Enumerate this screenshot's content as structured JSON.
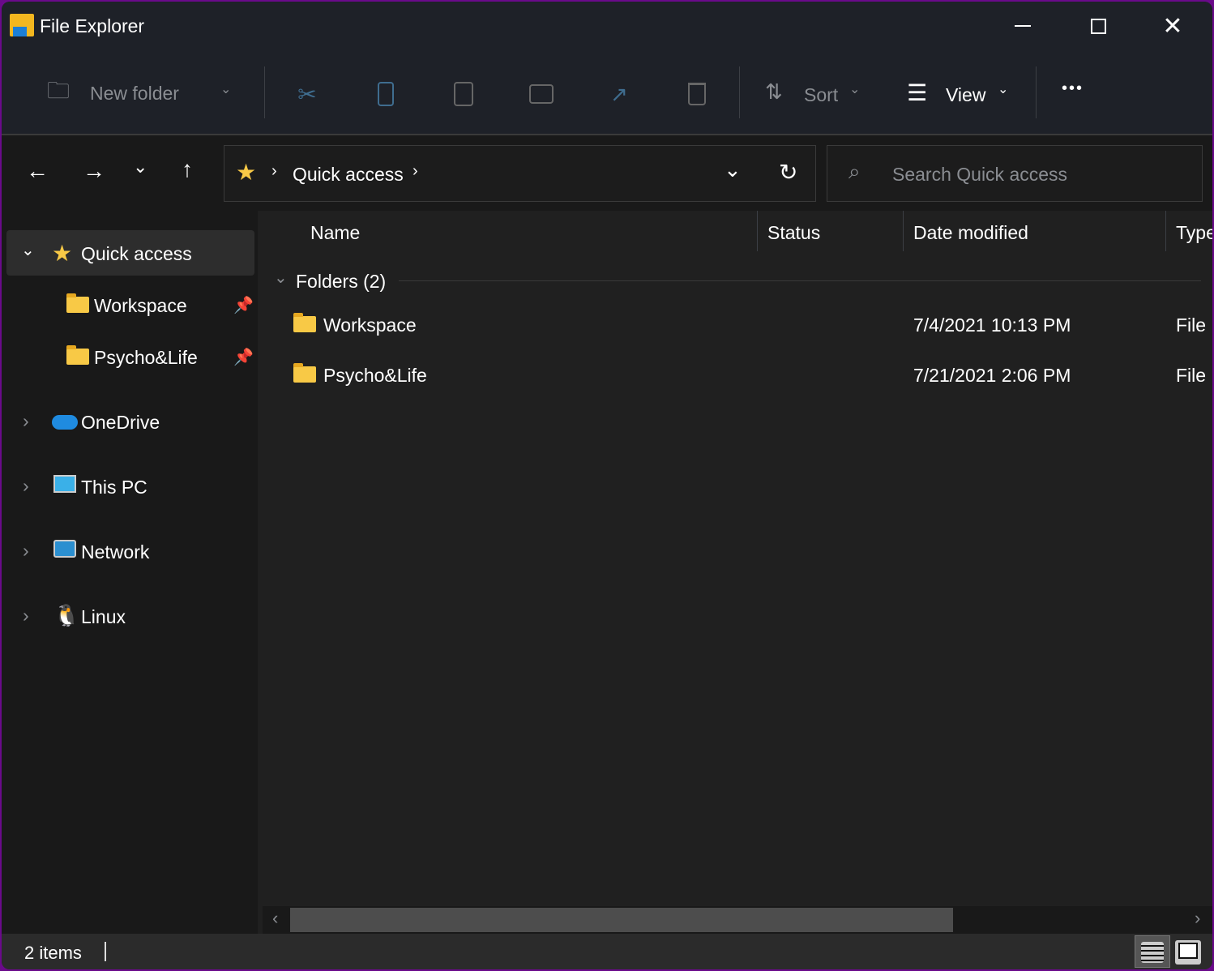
{
  "window": {
    "title": "File Explorer"
  },
  "toolbar": {
    "new_folder": "New folder",
    "sort": "Sort",
    "view": "View",
    "more": "•••"
  },
  "address": {
    "segments": [
      "Quick access"
    ],
    "search_placeholder": "Search Quick access"
  },
  "sidebar": {
    "items": [
      {
        "label": "Quick access",
        "icon": "star-icon"
      },
      {
        "label": "Workspace",
        "icon": "folder-icon",
        "pinned": true
      },
      {
        "label": "Psycho&Life",
        "icon": "folder-icon",
        "pinned": true
      },
      {
        "label": "OneDrive",
        "icon": "cloud-icon"
      },
      {
        "label": "This PC",
        "icon": "monitor-icon"
      },
      {
        "label": "Network",
        "icon": "network-icon"
      },
      {
        "label": "Linux",
        "icon": "penguin-icon"
      }
    ]
  },
  "columns": [
    "Name",
    "Status",
    "Date modified",
    "Type"
  ],
  "group": "Folders (2)",
  "rows": [
    {
      "name": "Workspace",
      "date": "7/4/2021 10:13 PM",
      "type": "File"
    },
    {
      "name": "Psycho&Life",
      "date": "7/21/2021 2:06 PM",
      "type": "File"
    }
  ],
  "status": {
    "count": "2 items"
  },
  "colors": {
    "accent": "#f8c946",
    "border": "#6a0a8a"
  }
}
